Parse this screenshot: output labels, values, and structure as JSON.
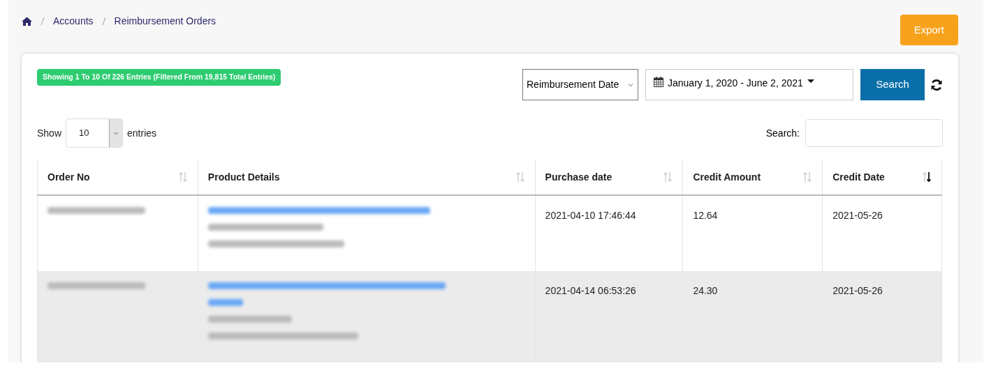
{
  "breadcrumb": [
    "Accounts",
    "Reimbursement Orders"
  ],
  "export_button": "Export",
  "entries_badge": "Showing 1 To 10 Of 226 Entries (Filtered From 19,815 Total Entries)",
  "date_type_select": "Reimbursement Date",
  "date_range": "January 1, 2020 - June 2, 2021",
  "search_button": "Search",
  "page_length": {
    "before": "Show",
    "value": "10",
    "after": "entries"
  },
  "search_label": "Search:",
  "columns": [
    {
      "label": "Order No",
      "sorted": false
    },
    {
      "label": "Product Details",
      "sorted": false
    },
    {
      "label": "Purchase date",
      "sorted": false
    },
    {
      "label": "Credit Amount",
      "sorted": false
    },
    {
      "label": "Credit Date",
      "sorted": true
    }
  ],
  "rows": [
    {
      "product": [
        {
          "kind": "link"
        },
        {
          "kind": "text"
        },
        {
          "kind": "text"
        }
      ],
      "purchase_date": "2021-04-10 17:46:44",
      "credit_amount": "12.64",
      "credit_date": "2021-05-26",
      "selected": false
    },
    {
      "product": [
        {
          "kind": "link"
        },
        {
          "kind": "link"
        },
        {
          "kind": "text"
        },
        {
          "kind": "text"
        }
      ],
      "purchase_date": "2021-04-14 06:53:26",
      "credit_amount": "24.30",
      "credit_date": "2021-05-26",
      "selected": true
    }
  ]
}
